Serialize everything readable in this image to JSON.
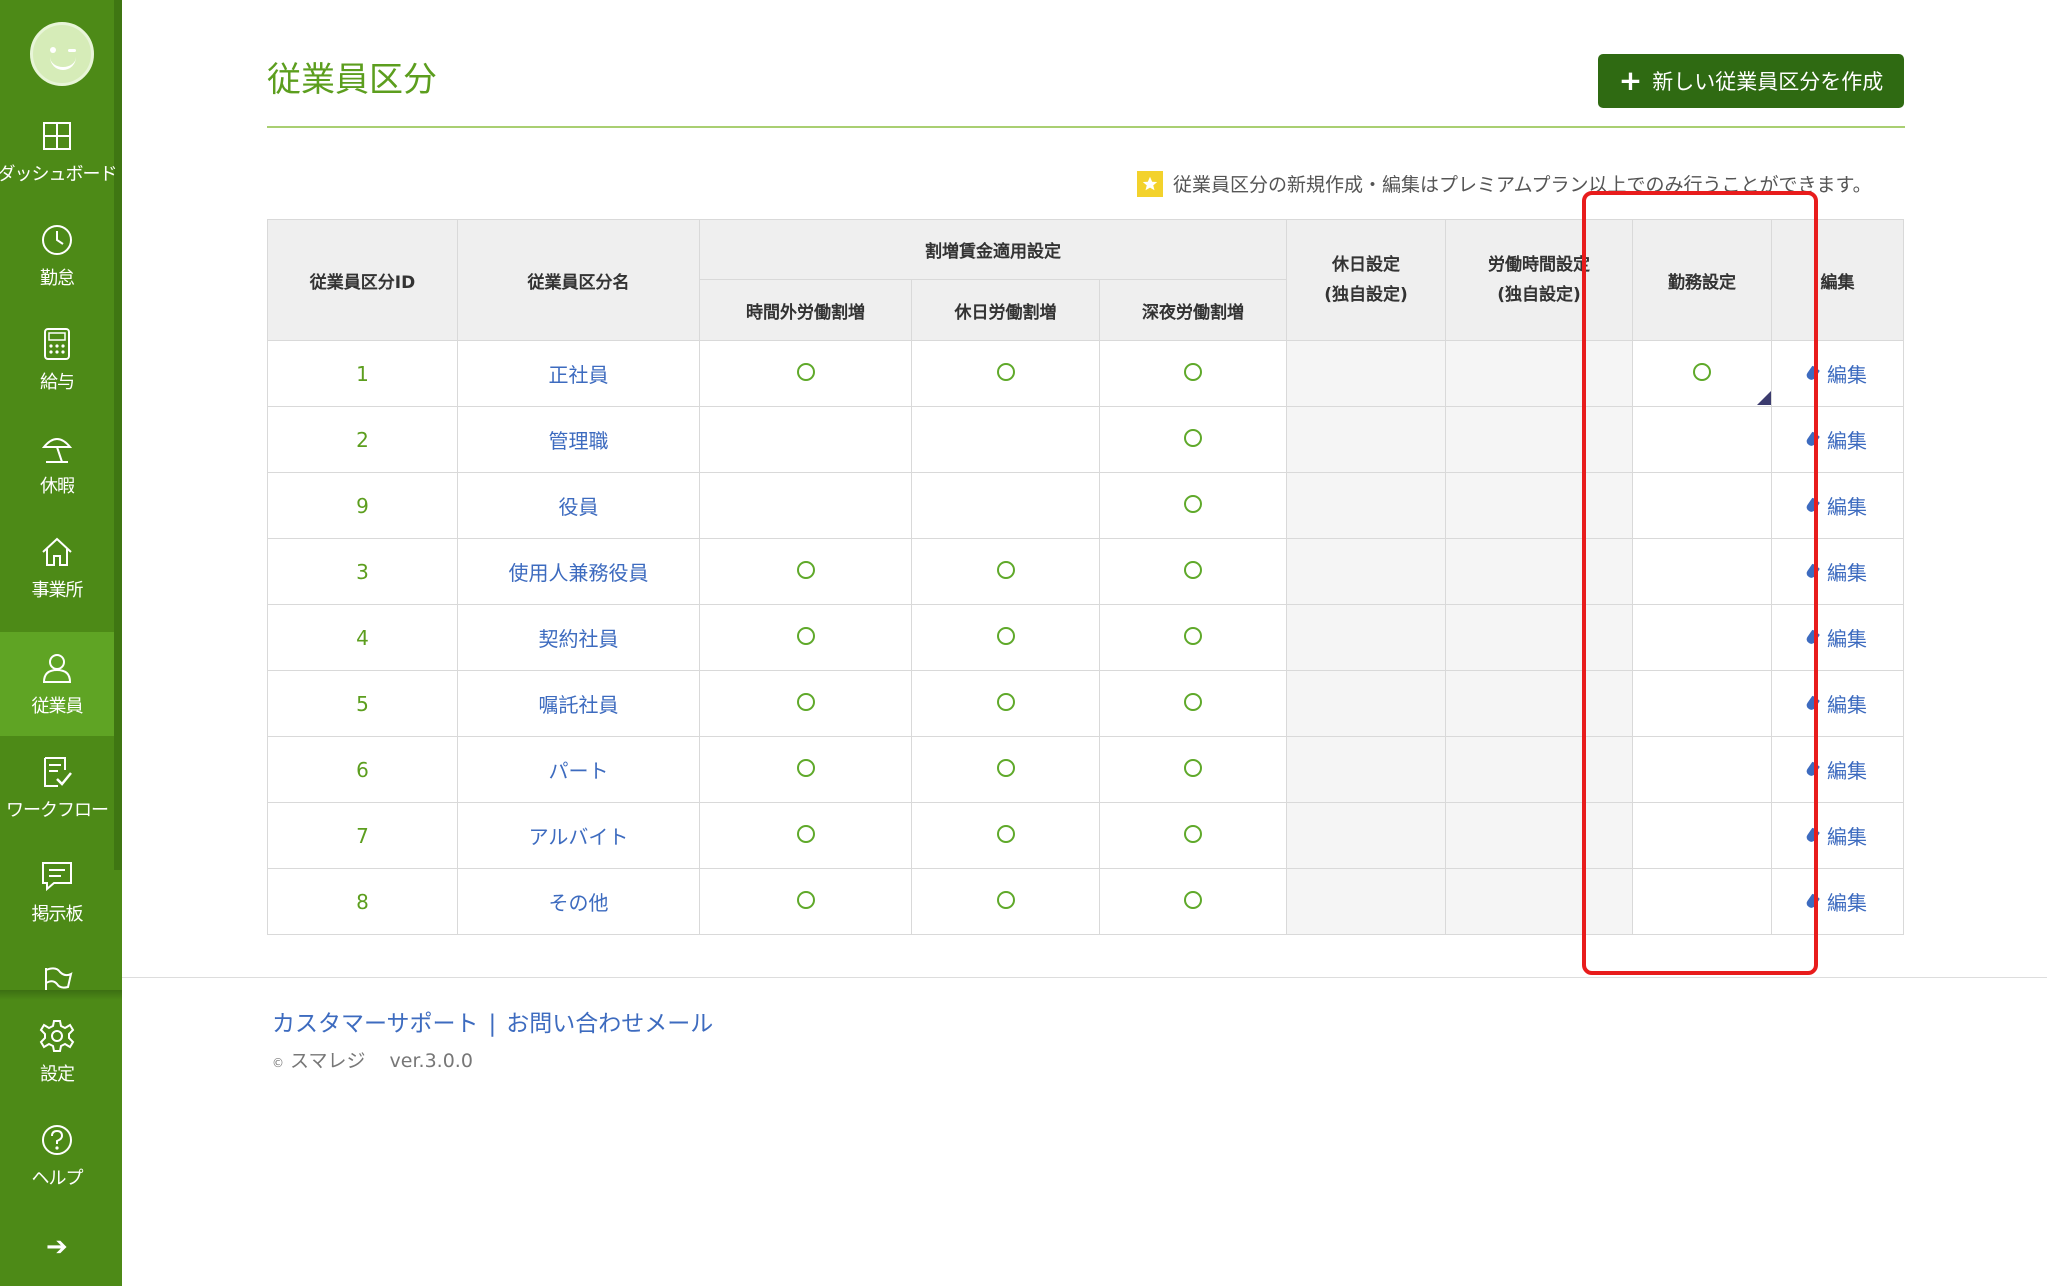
{
  "sidebar": {
    "items": [
      {
        "label": "ダッシュボード",
        "icon": "dashboard-icon"
      },
      {
        "label": "勤怠",
        "icon": "clock-icon"
      },
      {
        "label": "給与",
        "icon": "calculator-icon"
      },
      {
        "label": "休暇",
        "icon": "parasol-icon"
      },
      {
        "label": "事業所",
        "icon": "house-icon"
      },
      {
        "label": "従業員",
        "icon": "person-icon"
      },
      {
        "label": "ワークフロー",
        "icon": "checklist-icon"
      },
      {
        "label": "掲示板",
        "icon": "message-icon"
      },
      {
        "label": "",
        "icon": "flag-icon"
      },
      {
        "label": "設定",
        "icon": "gear-icon"
      },
      {
        "label": "ヘルプ",
        "icon": "help-icon"
      }
    ],
    "active": "従業員",
    "expand_icon": "arrow-right-icon"
  },
  "page": {
    "title": "従業員区分",
    "create_button": "新しい従業員区分を作成",
    "notice": "従業員区分の新規作成・編集はプレミアムプラン以上でのみ行うことができます。"
  },
  "table": {
    "headers": {
      "id": "従業員区分ID",
      "name": "従業員区分名",
      "surcharge_group": "割増賃金適用設定",
      "overtime": "時間外労働割増",
      "holiday_work": "休日労働割増",
      "night_work": "深夜労働割増",
      "holiday_setting": [
        "休日設定",
        "(独自設定)"
      ],
      "work_hours_setting": [
        "労働時間設定",
        "(独自設定)"
      ],
      "duty_setting": "勤務設定",
      "edit": "編集"
    },
    "rows": [
      {
        "id": "1",
        "name": "正社員",
        "overtime": true,
        "holiday_work": true,
        "night_work": true,
        "holiday_setting": false,
        "work_hours_setting": false,
        "duty_setting": true,
        "edit": "編集"
      },
      {
        "id": "2",
        "name": "管理職",
        "overtime": false,
        "holiday_work": false,
        "night_work": true,
        "holiday_setting": false,
        "work_hours_setting": false,
        "duty_setting": false,
        "edit": "編集"
      },
      {
        "id": "9",
        "name": "役員",
        "overtime": false,
        "holiday_work": false,
        "night_work": true,
        "holiday_setting": false,
        "work_hours_setting": false,
        "duty_setting": false,
        "edit": "編集"
      },
      {
        "id": "3",
        "name": "使用人兼務役員",
        "overtime": true,
        "holiday_work": true,
        "night_work": true,
        "holiday_setting": false,
        "work_hours_setting": false,
        "duty_setting": false,
        "edit": "編集"
      },
      {
        "id": "4",
        "name": "契約社員",
        "overtime": true,
        "holiday_work": true,
        "night_work": true,
        "holiday_setting": false,
        "work_hours_setting": false,
        "duty_setting": false,
        "edit": "編集"
      },
      {
        "id": "5",
        "name": "嘱託社員",
        "overtime": true,
        "holiday_work": true,
        "night_work": true,
        "holiday_setting": false,
        "work_hours_setting": false,
        "duty_setting": false,
        "edit": "編集"
      },
      {
        "id": "6",
        "name": "パート",
        "overtime": true,
        "holiday_work": true,
        "night_work": true,
        "holiday_setting": false,
        "work_hours_setting": false,
        "duty_setting": false,
        "edit": "編集"
      },
      {
        "id": "7",
        "name": "アルバイト",
        "overtime": true,
        "holiday_work": true,
        "night_work": true,
        "holiday_setting": false,
        "work_hours_setting": false,
        "duty_setting": false,
        "edit": "編集"
      },
      {
        "id": "8",
        "name": "その他",
        "overtime": true,
        "holiday_work": true,
        "night_work": true,
        "holiday_setting": false,
        "work_hours_setting": false,
        "duty_setting": false,
        "edit": "編集"
      }
    ]
  },
  "footer": {
    "support_link": "カスタマーサポート",
    "separator": "|",
    "mail_link": "お問い合わせメール",
    "copyright_symbol": "©",
    "brand": "スマレジ",
    "version": "ver.3.0.0"
  },
  "colors": {
    "sidebar": "#4d8a17",
    "accent_green": "#5c9e1e",
    "button": "#2f6a12",
    "link": "#3d6bbf",
    "highlight": "#e81c1c"
  }
}
